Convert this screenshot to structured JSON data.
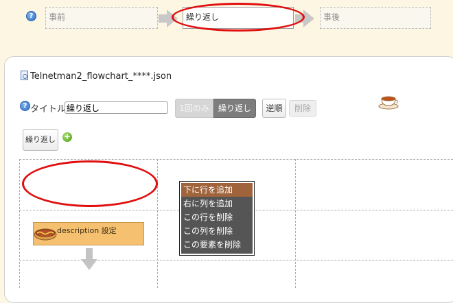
{
  "steps": {
    "before": "事前",
    "loop": "繰り返し",
    "after": "事後"
  },
  "file": {
    "name": "Telnetman2_flowchart_****.json",
    "icon": "file-icon"
  },
  "toolbar": {
    "title_label": "タイトル",
    "title_value": "繰り返し",
    "once_label": "1回のみ",
    "repeat_label": "繰り返し",
    "reverse_label": "逆順",
    "delete_label": "削除"
  },
  "flow": {
    "loop_button": "繰り返し",
    "description_label": "description 設定"
  },
  "context_menu": {
    "items": [
      "下に行を追加",
      "右に列を追加",
      "この行を削除",
      "この列を削除",
      "この要素を削除"
    ],
    "hover_index": 0
  },
  "colors": {
    "background": "#fdf6e3",
    "highlight_ellipse": "#e01010",
    "menu_bg": "#555555",
    "menu_hover": "#a0643c",
    "description_bg": "#f5c170"
  }
}
